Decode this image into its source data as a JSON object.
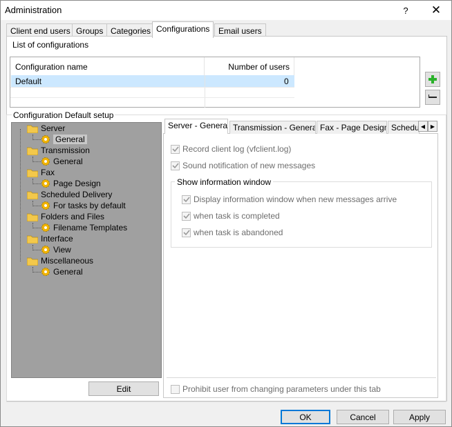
{
  "window": {
    "title": "Administration",
    "help_glyph": "?",
    "close_glyph": "✕"
  },
  "tabs": [
    {
      "label": "Client end users"
    },
    {
      "label": "Groups"
    },
    {
      "label": "Categories"
    },
    {
      "label": "Configurations"
    },
    {
      "label": "Email users"
    }
  ],
  "configurations": {
    "list_label": "List of configurations",
    "columns": [
      "Configuration name",
      "Number of users"
    ],
    "rows": [
      {
        "name": "Default",
        "users": "0"
      }
    ],
    "add_icon": "plus-icon",
    "remove_icon": "minus-icon"
  },
  "setup": {
    "group_label": "Configuration Default setup",
    "tree": [
      {
        "label": "Server",
        "children": [
          "General"
        ]
      },
      {
        "label": "Transmission",
        "children": [
          "General"
        ]
      },
      {
        "label": "Fax",
        "children": [
          "Page Design"
        ]
      },
      {
        "label": "Scheduled Delivery",
        "children": [
          "For tasks by default"
        ]
      },
      {
        "label": "Folders and Files",
        "children": [
          "Filename Templates"
        ]
      },
      {
        "label": "Interface",
        "children": [
          "View"
        ]
      },
      {
        "label": "Miscellaneous",
        "children": [
          "General"
        ]
      }
    ],
    "edit_label": "Edit",
    "inner_tabs": [
      "Server - General",
      "Transmission - General",
      "Fax - Page Design",
      "Schedu"
    ],
    "options": {
      "record_log": "Record client log (vfclient.log)",
      "sound_notify": "Sound notification of new messages",
      "show_window_group": "Show information window",
      "display_window": "Display information window when new messages arrive",
      "task_completed": "when task is completed",
      "task_abandoned": "when task is abandoned",
      "prohibit": "Prohibit user from changing parameters under this tab"
    }
  },
  "footer": {
    "ok": "OK",
    "cancel": "Cancel",
    "apply": "Apply"
  },
  "colors": {
    "accent": "#0078d7",
    "selection": "#cce8ff",
    "folder": "#f3c84b",
    "gear": "#f2b400",
    "plus": "#2ab12a"
  }
}
